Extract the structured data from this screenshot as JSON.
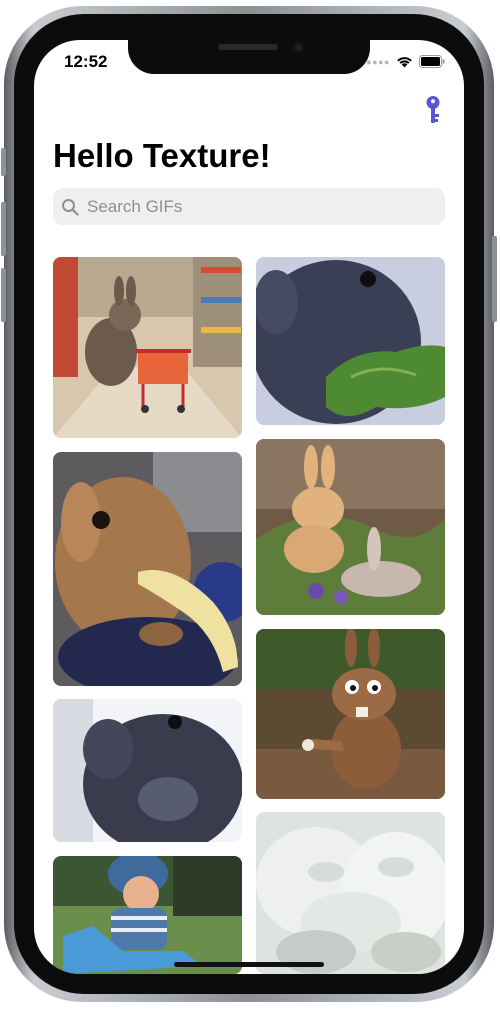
{
  "status_bar": {
    "time": "12:52"
  },
  "header": {
    "title": "Hello Texture!"
  },
  "search": {
    "placeholder": "Search GIFs",
    "value": ""
  },
  "icons": {
    "key": "key-icon",
    "search": "search-icon",
    "wifi": "wifi-icon",
    "battery": "battery-icon"
  },
  "colors": {
    "accent": "#5856d6"
  },
  "grid": {
    "tiles": [
      {
        "name": "gif-tile-bunny-shopping-cart",
        "colors": [
          "#cdb596",
          "#6e5a4b",
          "#e8643a"
        ]
      },
      {
        "name": "gif-tile-gray-bunny-eating-greens",
        "colors": [
          "#3b3f55",
          "#4e8a32",
          "#9aa0b8"
        ]
      },
      {
        "name": "gif-tile-bunny-eating-banana",
        "colors": [
          "#a4774d",
          "#2a2f56",
          "#efe2a0"
        ]
      },
      {
        "name": "gif-tile-cartoon-bunnies",
        "colors": [
          "#6f5a46",
          "#e2b27e",
          "#5e7d3b"
        ]
      },
      {
        "name": "gif-tile-gray-bunny-closeup",
        "colors": [
          "#3a3c4d",
          "#cfd3de",
          "#7b7f92"
        ]
      },
      {
        "name": "gif-tile-claymation-rabbit",
        "colors": [
          "#6e4a35",
          "#9c6a45",
          "#3f5a2a"
        ]
      },
      {
        "name": "gif-tile-baby-on-toy",
        "colors": [
          "#3e6a9c",
          "#e9b18d",
          "#4f7b3d"
        ]
      },
      {
        "name": "gif-tile-white-bunnies",
        "colors": [
          "#e9ece9",
          "#c7ccc8",
          "#a8b0aa"
        ]
      }
    ]
  }
}
